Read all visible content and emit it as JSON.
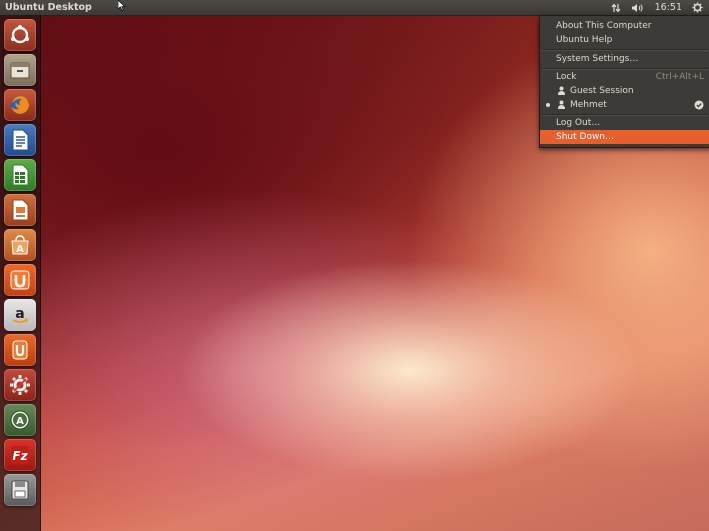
{
  "top_panel": {
    "title": "Ubuntu Desktop",
    "clock": "16:51"
  },
  "launcher": {
    "items": [
      {
        "name": "dash-home-icon"
      },
      {
        "name": "files-icon"
      },
      {
        "name": "firefox-icon"
      },
      {
        "name": "libreoffice-writer-icon"
      },
      {
        "name": "libreoffice-calc-icon"
      },
      {
        "name": "libreoffice-impress-icon"
      },
      {
        "name": "software-center-icon"
      },
      {
        "name": "ubuntu-one-icon"
      },
      {
        "name": "amazon-icon"
      },
      {
        "name": "ubuntu-one-music-icon"
      },
      {
        "name": "system-settings-icon"
      },
      {
        "name": "update-manager-icon"
      },
      {
        "name": "filezilla-icon"
      },
      {
        "name": "save-disk-icon"
      }
    ]
  },
  "session_menu": {
    "about": "About This Computer",
    "help": "Ubuntu Help",
    "settings": "System Settings…",
    "lock": "Lock",
    "lock_shortcut": "Ctrl+Alt+L",
    "guest": "Guest Session",
    "user": "Mehmet",
    "logout": "Log Out…",
    "shutdown": "Shut Down…"
  },
  "colors": {
    "accent": "#e65f2c",
    "panel": "#3c3b37"
  }
}
